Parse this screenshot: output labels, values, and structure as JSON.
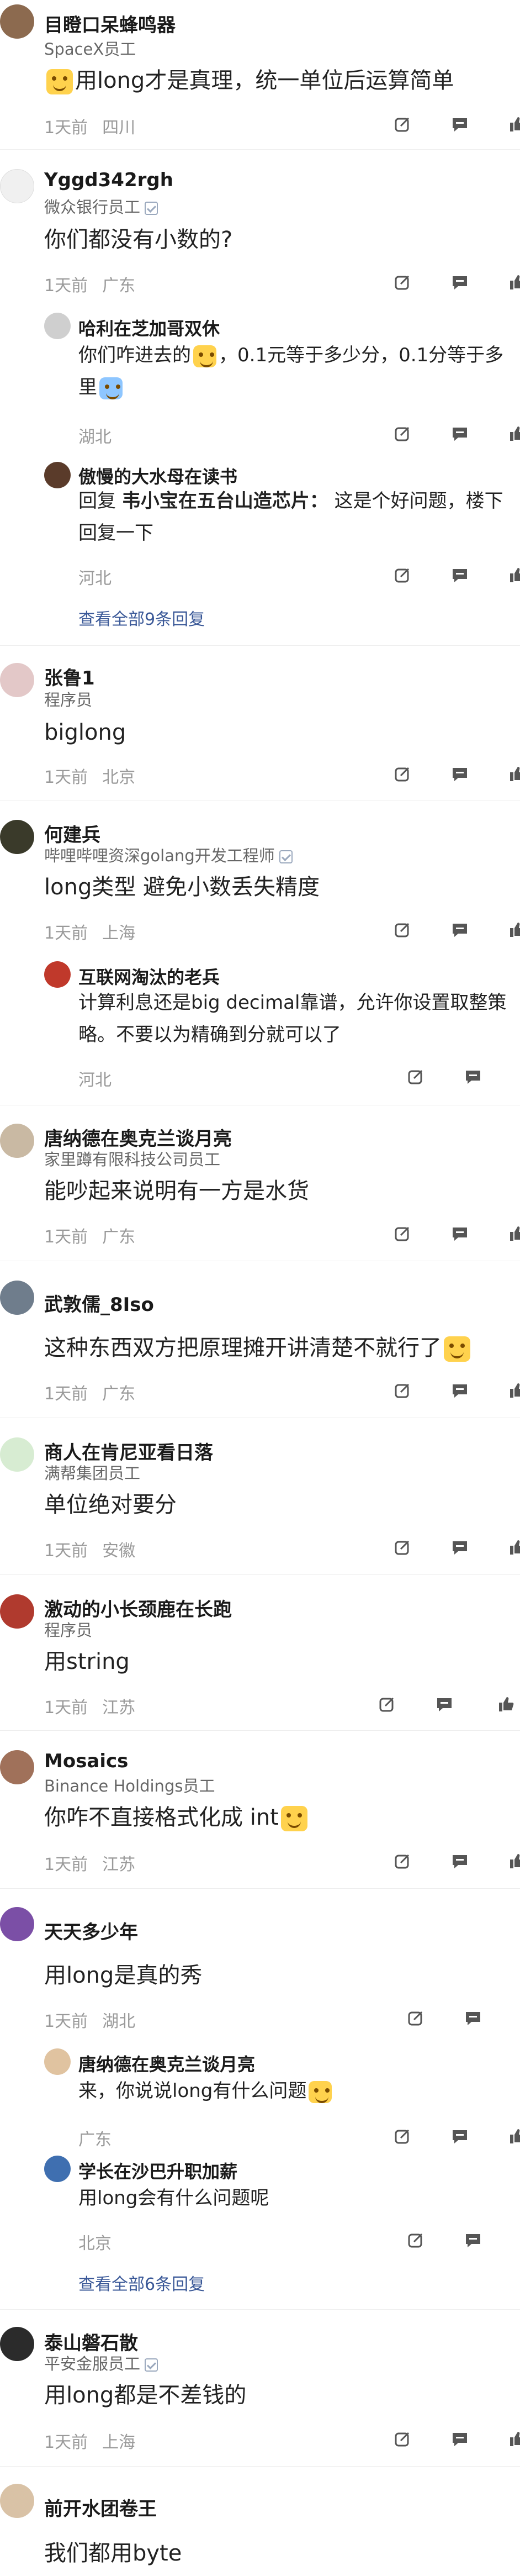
{
  "colors": {
    "link": "#3b5998",
    "meta": "#9a9a9a",
    "divider": "#eeeeee"
  },
  "comments": [
    {
      "user": "目瞪口呆蜂鸣器",
      "title": "SpaceX员工",
      "text": "用long才是真理，统一单位后运算简单",
      "time": "1天前",
      "region": "四川"
    },
    {
      "user": "Yggd342rgh",
      "title": "微众银行员工",
      "text": "你们都没有小数的?",
      "time": "1天前",
      "region": "广东",
      "replies": [
        {
          "user": "哈利在芝加哥双休",
          "line1": "你们咋进去的",
          "line1b": "，0.1元等于多少分，0.1分等于多",
          "line2": "里",
          "time": "湖北"
        },
        {
          "user": "傲慢的大水母在读书",
          "line1a": "回复",
          "line1b": "韦小宝在五台山造芯片：",
          "line1c": "这是个好问题，楼下",
          "line2": "回复一下",
          "time": "河北"
        }
      ],
      "view_more": "查看全部9条回复"
    },
    {
      "user": "张鲁1",
      "title": "程序员",
      "text": "biglong",
      "time": "1天前",
      "region": "北京"
    },
    {
      "user": "何建兵",
      "title": "哔哩哔哩资深golang开发工程师",
      "text": "long类型 避免小数丢失精度",
      "time": "1天前",
      "region": "上海",
      "replies": [
        {
          "user": "互联网淘汰的老兵",
          "line1": "计算利息还是big decimal靠谱，允许你设置取整策",
          "line2": "略。不要以为精确到分就可以了",
          "time": "河北"
        }
      ]
    },
    {
      "user": "唐纳德在奥克兰谈月亮",
      "title": "家里蹲有限科技公司员工",
      "text": "能吵起来说明有一方是水货",
      "time": "1天前",
      "region": "广东"
    },
    {
      "user": "武敦儒_8Iso",
      "title": "",
      "text": "这种东西双方把原理摊开讲清楚不就行了",
      "time": "1天前",
      "region": "广东"
    },
    {
      "user": "商人在肯尼亚看日落",
      "title": "满帮集团员工",
      "text": "单位绝对要分",
      "time": "1天前",
      "region": "安徽"
    },
    {
      "user": "激动的小长颈鹿在长跑",
      "title": "程序员",
      "text": "用string",
      "time": "1天前",
      "region": "江苏"
    },
    {
      "user": "Mosaics",
      "title": "Binance Holdings员工",
      "text": "你咋不直接格式化成 int",
      "time": "1天前",
      "region": "江苏"
    },
    {
      "user": "天天多少年",
      "title": "",
      "text": "用long是真的秀",
      "time": "1天前",
      "region": "湖北",
      "replies": [
        {
          "user": "唐纳德在奥克兰谈月亮",
          "line1": "来，你说说long有什么问题",
          "line2": "",
          "time": "广东"
        },
        {
          "user": "学长在沙巴升职加薪",
          "line1": "用long会有什么问题呢",
          "line2": "",
          "time": "北京"
        }
      ],
      "view_more": "查看全部6条回复"
    },
    {
      "user": "泰山磐石散",
      "title": "平安金服员工",
      "text": "用long都是不差钱的",
      "time": "1天前",
      "region": "上海"
    },
    {
      "user": "前开水团卷王",
      "title": "",
      "text": "我们都用byte",
      "time": "",
      "region": ""
    }
  ]
}
